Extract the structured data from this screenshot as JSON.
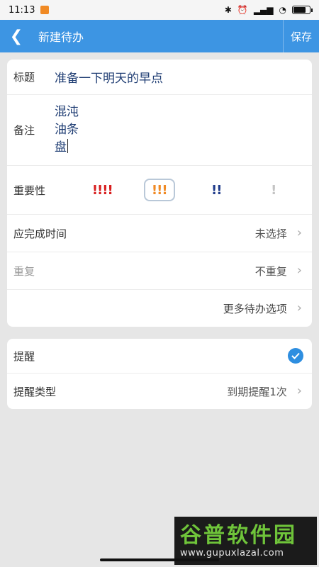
{
  "status_bar": {
    "time": "11:13",
    "battery": "87"
  },
  "header": {
    "title": "新建待办",
    "save_label": "保存"
  },
  "form": {
    "title_label": "标题",
    "title_value": "准备一下明天的早点",
    "notes_label": "备注",
    "notes_lines": [
      "混沌",
      "油条",
      "盘"
    ],
    "importance_label": "重要性",
    "importance_options": [
      {
        "label": "!!!!",
        "color": "#d81e1e"
      },
      {
        "label": "!!!",
        "color": "#f08a24",
        "selected": true
      },
      {
        "label": "!!",
        "color": "#1e3a8a"
      },
      {
        "label": "!",
        "color": "#c4c4c4"
      }
    ],
    "due_label": "应完成时间",
    "due_value": "未选择",
    "repeat_label": "重复",
    "repeat_value": "不重复",
    "more_options": "更多待办选项"
  },
  "reminder": {
    "label": "提醒",
    "checked": true,
    "type_label": "提醒类型",
    "type_value": "到期提醒1次"
  },
  "watermark": {
    "title": "谷普软件园",
    "url": "www.gupuxlazal.com"
  },
  "colors": {
    "accent": "#3d95e3",
    "text_blue": "#1f3d73"
  }
}
